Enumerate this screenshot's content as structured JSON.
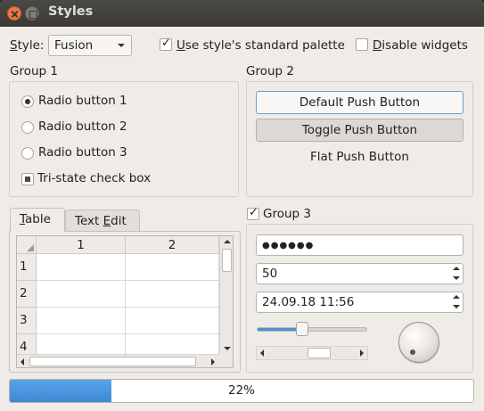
{
  "window": {
    "title": "Styles"
  },
  "top": {
    "style_label_mnemonic": "S",
    "style_label_rest": "tyle:",
    "style_value": "Fusion",
    "std_palette_mnemonic": "U",
    "std_palette_rest": "se style's standard palette",
    "std_palette_checked": true,
    "disable_mnemonic": "D",
    "disable_rest": "isable widgets",
    "disable_checked": false
  },
  "group1": {
    "title": "Group 1",
    "radio1": "Radio button 1",
    "radio2": "Radio button 2",
    "radio3": "Radio button 3",
    "selected_radio": 1,
    "tristate": "Tri-state check box",
    "tristate_state": "partial"
  },
  "group2": {
    "title": "Group 2",
    "default_button": "Default Push Button",
    "toggle_button": "Toggle Push Button",
    "flat_button": "Flat Push Button"
  },
  "tabs": {
    "table_mnemonic": "T",
    "table_rest": "able",
    "textedit_pre": "Text ",
    "textedit_mnemonic": "E",
    "textedit_rest": "dit",
    "active": "Table"
  },
  "table": {
    "columns": [
      "1",
      "2"
    ],
    "rows": [
      "1",
      "2",
      "3",
      "4"
    ]
  },
  "group3": {
    "title": "Group 3",
    "checked": true,
    "password": "●●●●●●",
    "spin_value": "50",
    "datetime": "24.09.18 11:56",
    "slider_percent": 40
  },
  "progress": {
    "value": 22,
    "text": "22%"
  },
  "colors": {
    "accent": "#3b8ad6",
    "default_border": "#6c9bd1",
    "close": "#f07746"
  }
}
